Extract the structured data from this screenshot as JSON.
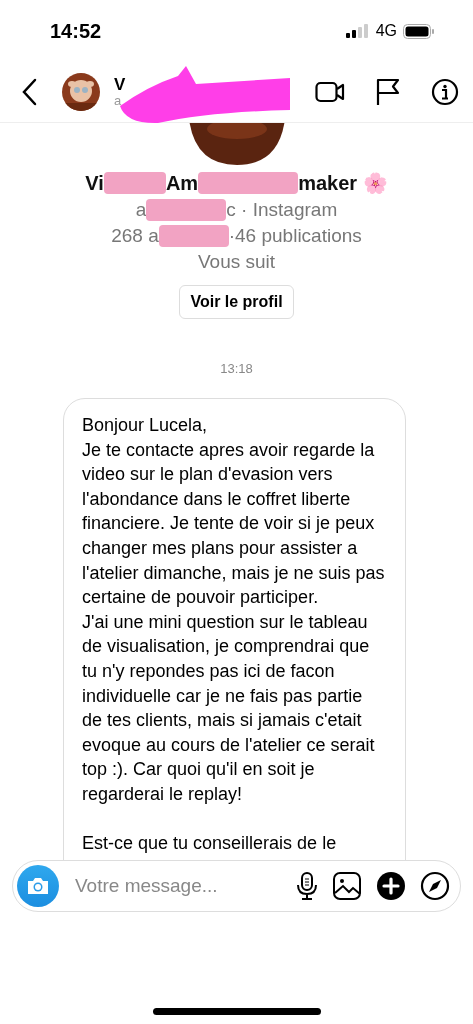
{
  "status_bar": {
    "time": "14:52",
    "network": "4G"
  },
  "header": {
    "name_fragment": "V",
    "handle_fragment": "a"
  },
  "profile": {
    "name_fragments": [
      "Vi",
      "Am",
      "maker 🌸"
    ],
    "handle_fragments": [
      "a",
      "c · Instagram"
    ],
    "stats_fragments": [
      "268 a",
      "·46 publications"
    ],
    "follow_status": "Vous suit",
    "button": "Voir le profil"
  },
  "timestamp": "13:18",
  "message": {
    "paragraphs": [
      "Bonjour Lucela,",
      "Je te contacte apres avoir regarde la video sur le plan d'evasion vers l'abondance dans le coffret liberte financiere. Je tente de voir si je peux changer mes plans pour assister a l'atelier dimanche, mais je ne suis pas certaine de pouvoir participer.",
      "J'ai une mini question sur le tableau de visualisation, je comprendrai que tu n'y repondes pas ici de facon individuelle car je ne fais pas partie de tes clients, mais si jamais c'etait evoque au cours de l'atelier ce serait top :). Car quoi qu'il en soit je regarderai le replay!",
      "Est-ce que tu conseillerais de le"
    ]
  },
  "composer": {
    "placeholder": "Votre message..."
  }
}
